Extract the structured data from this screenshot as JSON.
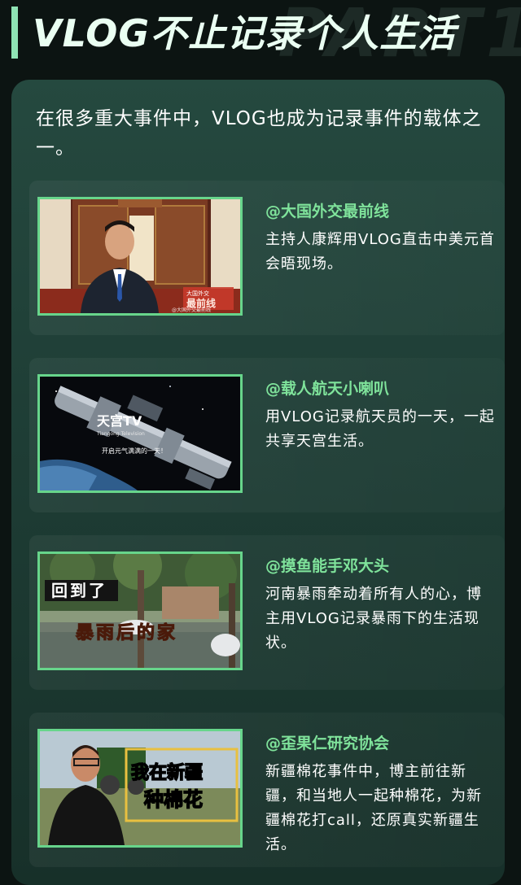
{
  "header": {
    "title": "VLOG不止记录个人生活",
    "bg_text": "PART1"
  },
  "intro": "在很多重大事件中，VLOG也成为记录事件的载体之一。",
  "items": [
    {
      "handle": "@大国外交最前线",
      "desc": "主持人康辉用VLOG直击中美元首会晤现场。",
      "thumb": {
        "logo": "大国外交",
        "tag": "最前线",
        "watermark": "@大国外交最前线"
      }
    },
    {
      "handle": "@载人航天小喇叭",
      "desc": "用VLOG记录航天员的一天，一起共享天宫生活。",
      "thumb": {
        "logo": "天宫TV",
        "sub": "Tiangong Television",
        "caption": "开启元气满满的一天！"
      }
    },
    {
      "handle": "@摸鱼能手邓大头",
      "desc": "河南暴雨牵动着所有人的心，博主用VLOG记录暴雨下的生活现状。",
      "thumb": {
        "line1": "回到了",
        "line2": "暴雨后的家"
      }
    },
    {
      "handle": "@歪果仁研究协会",
      "desc": "新疆棉花事件中，博主前往新疆，和当地人一起种棉花，为新疆棉花打call，还原真实新疆生活。",
      "thumb": {
        "line1": "我在新疆",
        "line2": "种棉花"
      }
    }
  ],
  "colors": {
    "accent": "#7fe39b",
    "border": "#67d58b",
    "bg": "#0c1412",
    "card": "#25493f"
  }
}
